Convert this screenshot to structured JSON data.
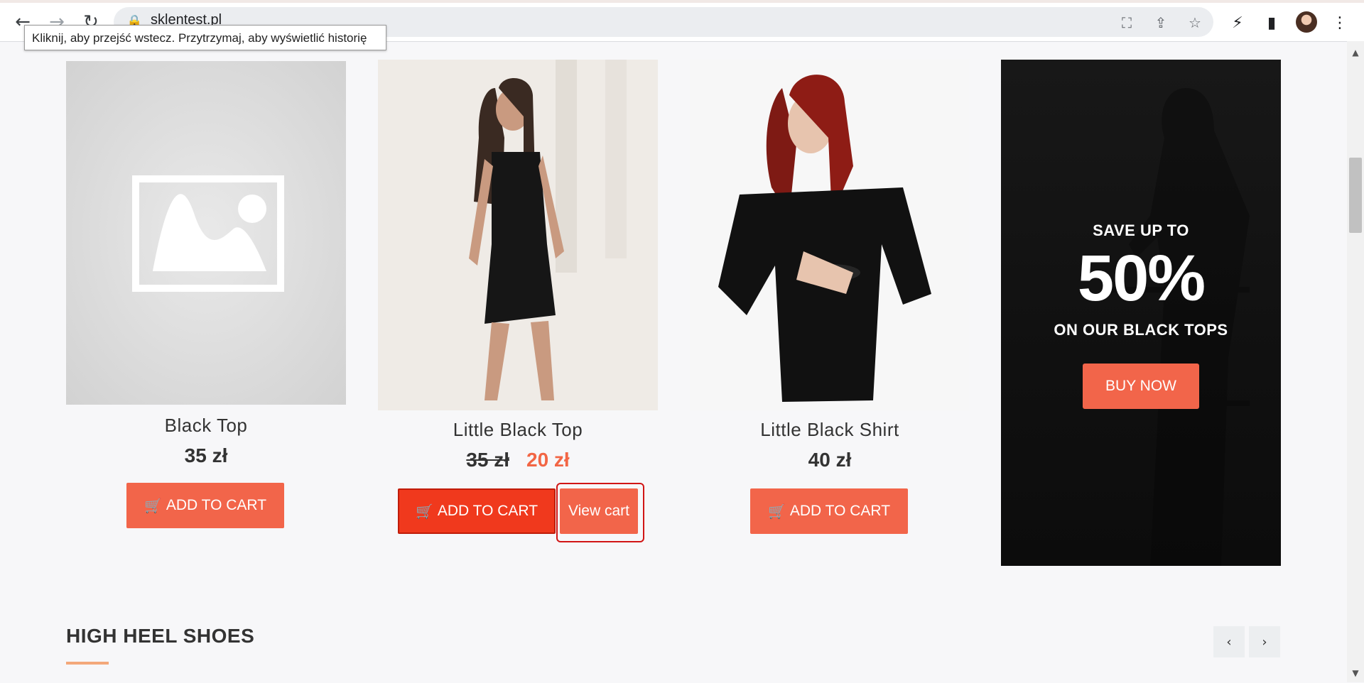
{
  "browser": {
    "url": "sklentest.pl",
    "back_icon": "arrow-left-icon",
    "forward_icon": "arrow-right-icon",
    "reload_icon": "reload-icon",
    "tooltip": "Kliknij, aby przejść wstecz. Przytrzymaj, aby wyświetlić historię"
  },
  "products": [
    {
      "name": "Black Top",
      "price": "35 zł",
      "button": "ADD TO CART"
    },
    {
      "name": "Little Black Top",
      "old_price": "35 zł",
      "sale_price": "20 zł",
      "button": "ADD TO CART",
      "view_cart": "View cart"
    },
    {
      "name": "Little Black Shirt",
      "price": "40 zł",
      "button": "ADD TO CART"
    }
  ],
  "promo": {
    "line1": "SAVE UP TO",
    "big": "50%",
    "line2": "ON OUR BLACK TOPS",
    "button": "BUY NOW"
  },
  "section": {
    "title": "HIGH HEEL SHOES"
  },
  "colors": {
    "accent": "#f2654a",
    "sale": "#f26645",
    "active_button": "#f0391d",
    "underline": "#f3a87a"
  }
}
